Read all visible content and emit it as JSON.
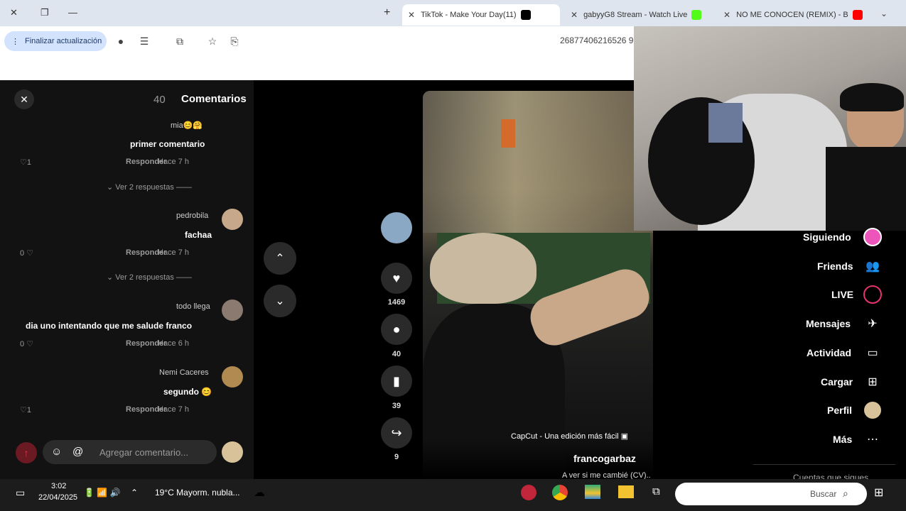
{
  "browser": {
    "tabs": [
      {
        "title": "NO ME CONOCEN (REMIX) - B",
        "favicon_color": "#ff0000"
      },
      {
        "title": "gabyyG8 Stream - Watch Live",
        "favicon_color": "#53fc18"
      },
      {
        "title": "(11)TikTok - Make Your Day",
        "favicon_color": "#000000"
      }
    ],
    "new_tab": "+",
    "url": "26877406216526 9",
    "update_button": "Finalizar actualización"
  },
  "comments": {
    "title": "Comentarios",
    "count": "40",
    "items": [
      {
        "user": "mia😊🤗",
        "text": "primer comentario",
        "time": "Hace 7 h",
        "reply": "Responder",
        "likes": "1",
        "replies": "Ver 2 respuestas"
      },
      {
        "user": "pedrobila",
        "text": "fachaa",
        "time": "Hace 7 h",
        "reply": "Responder",
        "likes": "0",
        "replies": "Ver 2 respuestas"
      },
      {
        "user": "todo llega",
        "text": "dia uno intentando que me salude franco",
        "time": "Hace 6 h",
        "reply": "Responder",
        "likes": "0"
      },
      {
        "user": "Nemi Caceres",
        "text": "segundo 😊",
        "time": "Hace 7 h",
        "reply": "Responder",
        "likes": "1"
      }
    ],
    "add_placeholder": "Agregar comentario..."
  },
  "actions": {
    "likes": "1469",
    "comments": "40",
    "saves": "39",
    "shares": "9"
  },
  "video": {
    "capcut": "CapCut - Una edición más fácil",
    "author": "francogarbaz",
    "caption": "A ver si me cambié (CV)..."
  },
  "sidebar": {
    "items": [
      {
        "label": "Siguiendo",
        "icon": "avatar-icon"
      },
      {
        "label": "Friends",
        "icon": "friends-icon"
      },
      {
        "label": "LIVE",
        "icon": "live-icon"
      },
      {
        "label": "Mensajes",
        "icon": "send-icon"
      },
      {
        "label": "Actividad",
        "icon": "activity-icon"
      },
      {
        "label": "Cargar",
        "icon": "plus-square-icon"
      },
      {
        "label": "Perfil",
        "icon": "profile-icon"
      },
      {
        "label": "Más",
        "icon": "more-icon"
      }
    ],
    "footer": "Cuentas que sigues"
  },
  "taskbar": {
    "search": "Buscar",
    "weather": "19°C  Mayorm. nubla...",
    "time": "3:02",
    "date": "22/04/2025"
  }
}
